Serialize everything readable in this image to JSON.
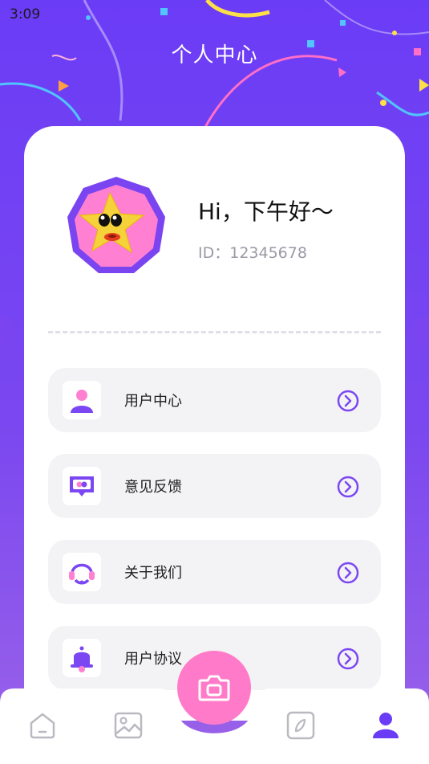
{
  "status_bar": {
    "time": "3:09"
  },
  "header": {
    "title": "个人中心"
  },
  "profile": {
    "greeting": "Hi，下午好～",
    "user_id": "ID：12345678",
    "avatar_icon": "star-avatar"
  },
  "menu": [
    {
      "label": "用户中心",
      "icon": "user-icon"
    },
    {
      "label": "意见反馈",
      "icon": "feedback-icon"
    },
    {
      "label": "关于我们",
      "icon": "headset-icon"
    },
    {
      "label": "用户协议",
      "icon": "bell-icon"
    }
  ],
  "tabbar": {
    "tabs": [
      {
        "icon": "home-icon",
        "active": false
      },
      {
        "icon": "image-icon",
        "active": false
      },
      {
        "icon": "camera-icon",
        "active": false
      },
      {
        "icon": "compass-icon",
        "active": false
      },
      {
        "icon": "profile-icon",
        "active": true
      }
    ]
  },
  "colors": {
    "primary": "#6b3cf6",
    "accent_pink": "#ff7bc9",
    "card_bg": "#ffffff",
    "menu_bg": "#f3f3f5"
  }
}
